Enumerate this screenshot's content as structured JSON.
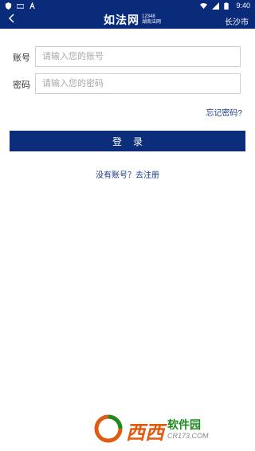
{
  "status_bar": {
    "time": "9:40",
    "icons": [
      "shield-icon",
      "keyboard-icon",
      "font-a-icon",
      "wifi-icon",
      "signal-icon",
      "battery-icon"
    ]
  },
  "app_bar": {
    "logo_main": "如法网",
    "logo_number": "12348",
    "logo_sub": "湖南法网",
    "city": "长沙市",
    "back_icon": "chevron-left-icon"
  },
  "form": {
    "account_label": "账号",
    "account_placeholder": "请输入您的账号",
    "account_value": "",
    "password_label": "密码",
    "password_placeholder": "请输入您的密码",
    "password_value": ""
  },
  "forgot_link": "忘记密码?",
  "login_button": "登录",
  "register_link": "没有账号？去注册",
  "watermark": {
    "main": "西西",
    "soft_title": "软件园",
    "domain": "CR173.COM"
  },
  "colors": {
    "primary": "#0c2d7a",
    "link": "#1a3a8a",
    "border": "#cfcfcf",
    "placeholder": "#a8a8a8"
  }
}
